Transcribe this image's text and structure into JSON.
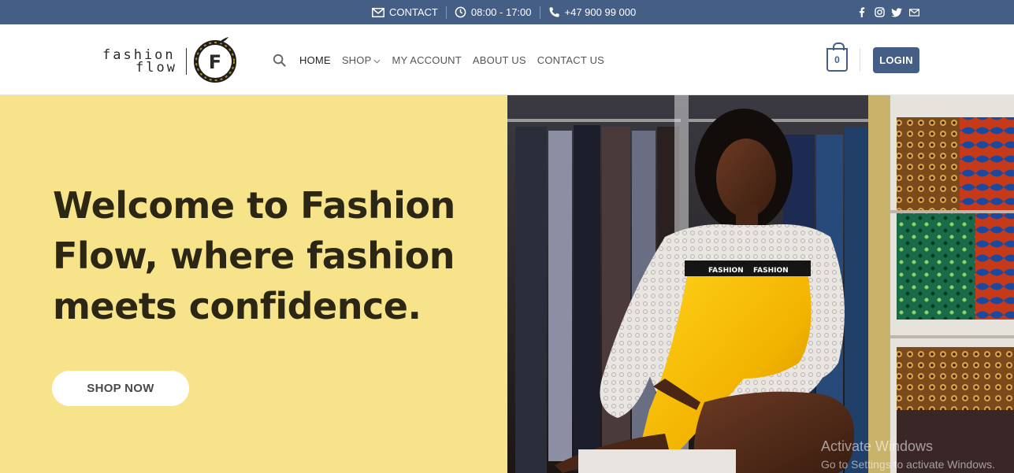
{
  "topbar": {
    "contact_label": "CONTACT",
    "hours": "08:00 - 17:00",
    "phone": "+47 900 99 000",
    "social_icons": [
      "facebook-icon",
      "instagram-icon",
      "twitter-icon",
      "email-icon"
    ]
  },
  "header": {
    "logo": {
      "line1": "fashion",
      "line2": "flow",
      "mark_letter": "F"
    },
    "nav": [
      {
        "label": "HOME"
      },
      {
        "label": "SHOP"
      },
      {
        "label": "MY ACCOUNT"
      },
      {
        "label": "ABOUT US"
      },
      {
        "label": "CONTACT US"
      }
    ],
    "cart_count": "0",
    "login_label": "LOGIN"
  },
  "hero": {
    "title": "Welcome to Fashion Flow, where fashion meets confidence.",
    "cta_label": "SHOP NOW",
    "image_garment_text_1": "FASHION",
    "image_garment_text_2": "FASHION"
  },
  "overlay": {
    "line1": "Activate Windows",
    "line2": "Go to Settings to activate Windows."
  },
  "colors": {
    "brand_blue": "#445e86",
    "hero_yellow": "#f7e389",
    "hero_text": "#2b2714"
  }
}
